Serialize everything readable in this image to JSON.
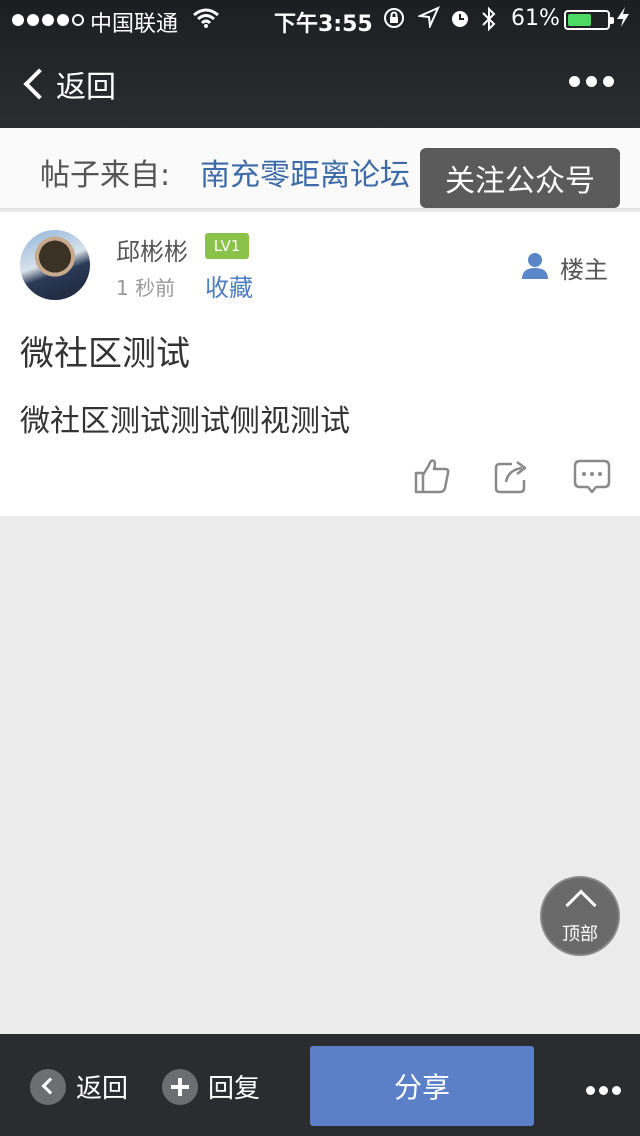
{
  "status_bar": {
    "carrier": "中国联通",
    "time": "下午3:55",
    "battery_percent": "61%",
    "battery_level": 0.61,
    "signal_bars_filled": 4,
    "signal_bars_total": 5
  },
  "nav": {
    "back_label": "返回",
    "more_icon": "more-dots-icon"
  },
  "source": {
    "prefix": "帖子来自:",
    "forum_name": "南充零距离论坛",
    "follow_label": "关注公众号"
  },
  "post": {
    "author": "邱彬彬",
    "level": "LV1",
    "time_ago": "1 秒前",
    "favorite_label": "收藏",
    "op_label": "楼主",
    "title": "微社区测试",
    "body": "微社区测试测试侧视测试",
    "actions": [
      "like-icon",
      "share-icon",
      "comment-icon"
    ]
  },
  "back_to_top": {
    "label": "顶部"
  },
  "bottom_bar": {
    "back_label": "返回",
    "reply_label": "回复",
    "share_label": "分享"
  },
  "colors": {
    "link": "#3d6aa8",
    "level_badge": "#8bc34a",
    "share_button": "#5b80c8",
    "battery": "#4cd964"
  }
}
